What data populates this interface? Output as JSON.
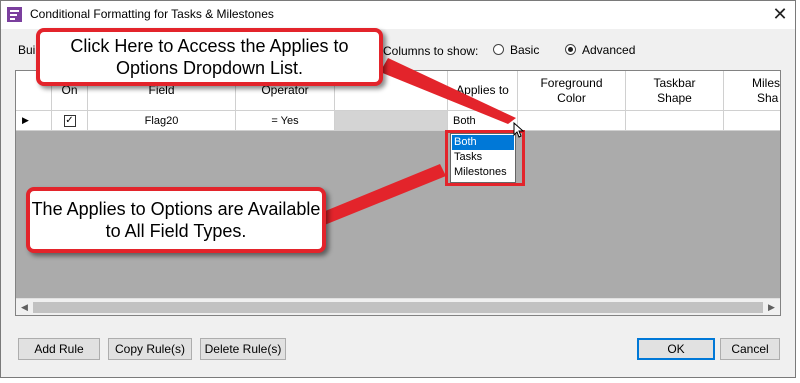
{
  "window": {
    "title": "Conditional Formatting for Tasks & Milestones",
    "close_glyph": "✕"
  },
  "options": {
    "build_label": "Bui",
    "columns_label": "Columns to show:",
    "basic_label": "Basic",
    "advanced_label": "Advanced",
    "selected": "Advanced"
  },
  "grid": {
    "columns": [
      {
        "label": ""
      },
      {
        "label": "On"
      },
      {
        "label": "Field"
      },
      {
        "label": "Operator"
      },
      {
        "label": ""
      },
      {
        "label": "Applies to"
      },
      {
        "label": "Foreground Color"
      },
      {
        "label": "Taskbar Shape"
      },
      {
        "label": "Milest Sha"
      }
    ],
    "row": {
      "arrow": "▶",
      "on_checked": "✓",
      "field": "Flag20",
      "operator": "= Yes"
    },
    "scroll_left": "◀",
    "scroll_right": "▶"
  },
  "dropdown": {
    "value": "Both",
    "arrow": "▼",
    "options": [
      "Both",
      "Tasks",
      "Milestones"
    ],
    "selected_index": 0
  },
  "callouts": {
    "top": "Click Here to Access the Applies to Options Dropdown List.",
    "bottom": "The Applies to Options are Available to All Field Types."
  },
  "buttons": {
    "add_rule": "Add Rule",
    "copy_rules": "Copy Rule(s)",
    "delete_rules": "Delete Rule(s)",
    "ok": "OK",
    "cancel": "Cancel"
  },
  "colors": {
    "callout_border": "#e3242b",
    "selection": "#0078d7",
    "grid_bg": "#ababab"
  }
}
